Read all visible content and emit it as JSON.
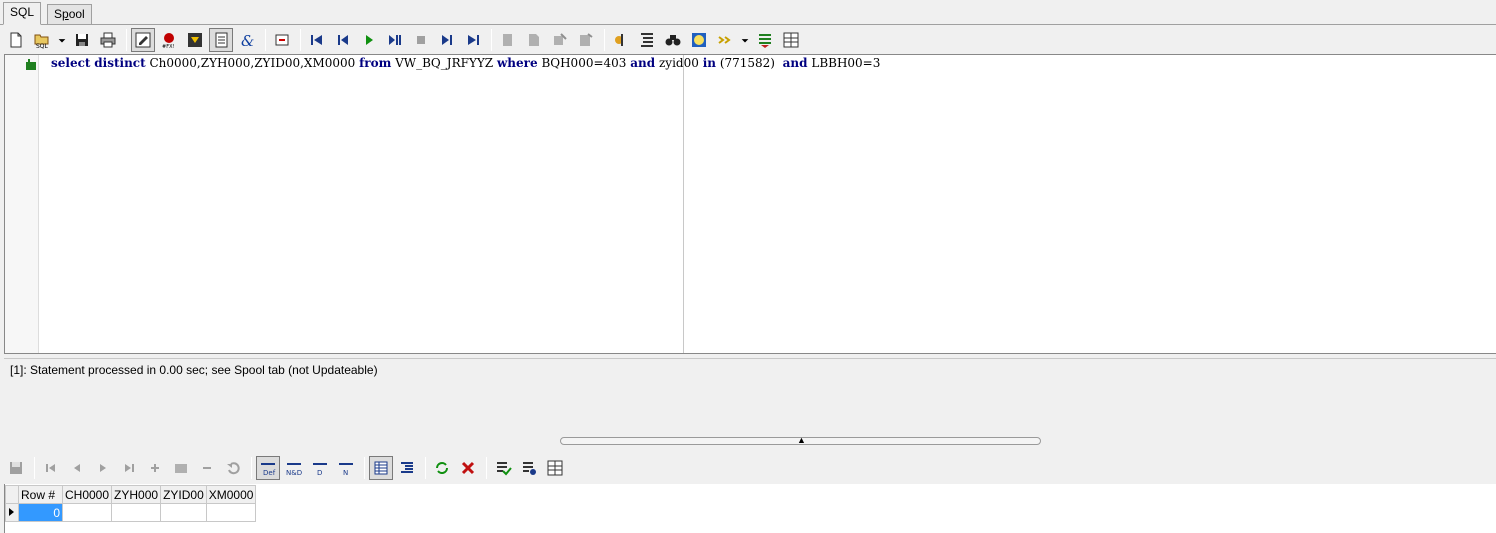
{
  "tabs": [
    {
      "label_pre": "SQL",
      "label_u": "",
      "label_post": "",
      "active": true
    },
    {
      "label_pre": "S",
      "label_u": "p",
      "label_post": "ool",
      "active": false
    }
  ],
  "editor": {
    "sql_parts": {
      "kw_select": "select",
      "kw_distinct": "distinct",
      "cols": "Ch0000,ZYH000,ZYID00,XM0000",
      "kw_from": "from",
      "table": "VW_BQ_JRFYYZ",
      "kw_where": "where",
      "cond1": "BQH000=403",
      "kw_and1": "and",
      "col2": "zyid00",
      "kw_in": "in",
      "inlist": "(771582)",
      "kw_and2": "and",
      "cond3": "LBBH00=3"
    }
  },
  "message": "[1]: Statement processed in 0.00 sec; see Spool tab (not Updateable)",
  "grid": {
    "columns": [
      "Row #",
      "CH0000",
      "ZYH000",
      "ZYID00",
      "XM0000"
    ],
    "rows": [
      [
        "0",
        "",
        "",
        "",
        ""
      ]
    ]
  }
}
